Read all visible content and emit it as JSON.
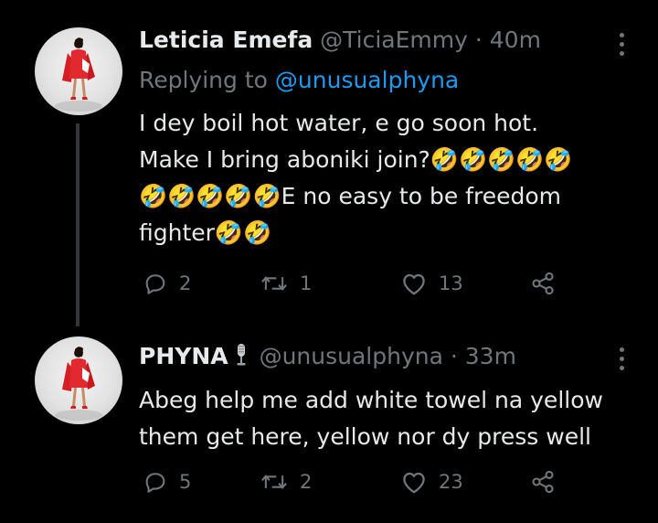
{
  "tweets": [
    {
      "author_name": "Leticia Emefa",
      "handle": "@TiciaEmmy",
      "separator": "·",
      "time": "40m",
      "replying_prefix": "Replying to",
      "replying_to": "@unusualphyna",
      "lines": [
        "I dey boil hot water, e go soon hot.",
        "Make I bring aboniki join?🤣🤣🤣🤣🤣",
        "🤣🤣🤣🤣🤣E no easy to be freedom",
        "fighter🤣🤣"
      ],
      "replies": "2",
      "retweets": "1",
      "likes": "13",
      "avatar_icon": "avatar-red-dress-woman"
    },
    {
      "author_name": "PHYNA",
      "name_emoji": "microphone",
      "handle": "@unusualphyna",
      "separator": "·",
      "time": "33m",
      "lines": [
        "Abeg help me add white towel na yellow",
        "them get here, yellow nor dy press well"
      ],
      "replies": "5",
      "retweets": "2",
      "likes": "23",
      "avatar_icon": "avatar-red-dress-woman"
    }
  ],
  "colors": {
    "background": "#000000",
    "text": "#e7e9ea",
    "secondary": "#71767b",
    "link": "#1d9bf0",
    "thread_line": "#333639"
  },
  "icons": {
    "more": "more-vertical-icon",
    "reply": "reply-icon",
    "retweet": "retweet-icon",
    "like": "heart-icon",
    "share": "share-icon"
  }
}
